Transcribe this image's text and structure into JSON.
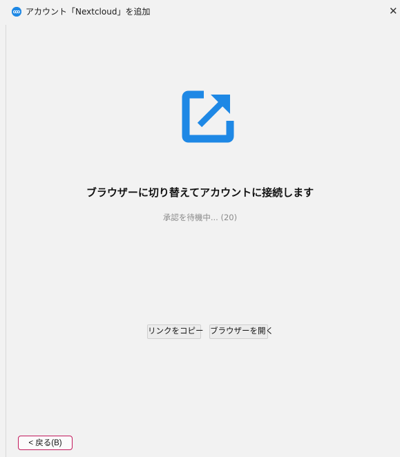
{
  "window": {
    "title": "アカウント「Nextcloud」を追加",
    "close_label": "✕"
  },
  "main": {
    "heading": "ブラウザーに切り替えてアカウントに接続します",
    "status": "承認を待機中... (20)",
    "copy_link_label": "リンクをコピー",
    "open_browser_label": "ブラウザーを開く",
    "link_icon": "external-link-icon"
  },
  "footer": {
    "back_label": "< 戻る(B)"
  },
  "colors": {
    "accent": "#1e88e5",
    "focus_border": "#c2185b",
    "background": "#f2f2f2"
  }
}
